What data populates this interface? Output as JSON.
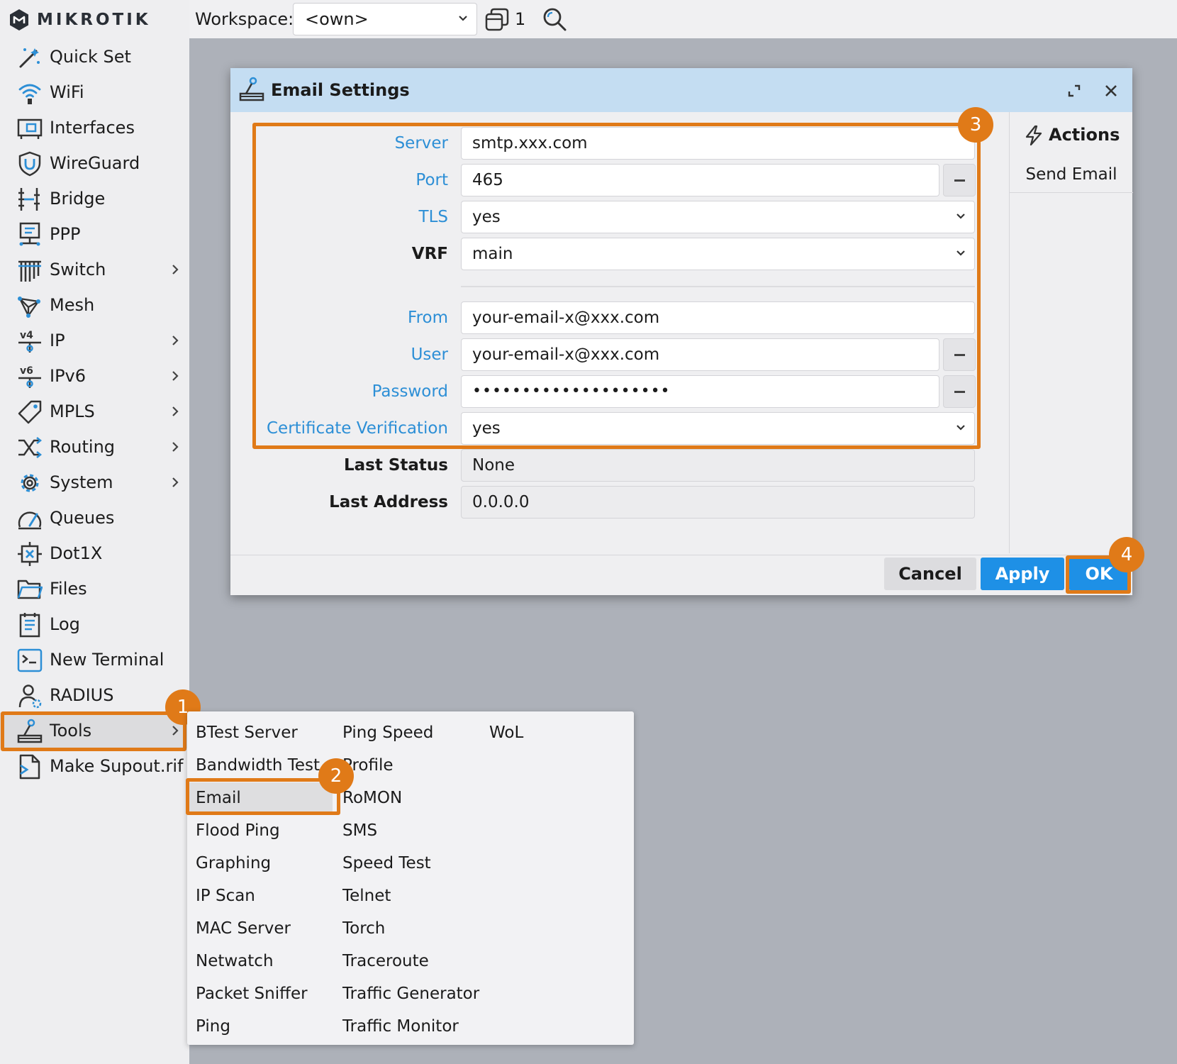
{
  "app": {
    "brand": "MikroTik",
    "logo_text": "MIKROTIK"
  },
  "colors": {
    "accent": "#e07a18",
    "primary_button": "#1e90e6",
    "field_label_blue": "#2d8fd6",
    "dialog_header": "#c4ddf2"
  },
  "topbar": {
    "workspace_label": "Workspace:",
    "workspace_value": "<own>",
    "window_count": "1"
  },
  "sidebar": {
    "items": [
      {
        "label": "Quick Set",
        "icon": "wand-icon",
        "submenu": false
      },
      {
        "label": "WiFi",
        "icon": "wifi-icon",
        "submenu": false
      },
      {
        "label": "Interfaces",
        "icon": "interfaces-icon",
        "submenu": false
      },
      {
        "label": "WireGuard",
        "icon": "wireguard-icon",
        "submenu": false
      },
      {
        "label": "Bridge",
        "icon": "bridge-icon",
        "submenu": false
      },
      {
        "label": "PPP",
        "icon": "ppp-icon",
        "submenu": false
      },
      {
        "label": "Switch",
        "icon": "switch-icon",
        "submenu": true
      },
      {
        "label": "Mesh",
        "icon": "mesh-icon",
        "submenu": false
      },
      {
        "label": "IP",
        "icon": "ip-icon",
        "submenu": true
      },
      {
        "label": "IPv6",
        "icon": "ipv6-icon",
        "submenu": true
      },
      {
        "label": "MPLS",
        "icon": "mpls-icon",
        "submenu": true
      },
      {
        "label": "Routing",
        "icon": "routing-icon",
        "submenu": true
      },
      {
        "label": "System",
        "icon": "gear-icon",
        "submenu": true
      },
      {
        "label": "Queues",
        "icon": "queues-icon",
        "submenu": false
      },
      {
        "label": "Dot1X",
        "icon": "dot1x-icon",
        "submenu": false
      },
      {
        "label": "Files",
        "icon": "folder-icon",
        "submenu": false
      },
      {
        "label": "Log",
        "icon": "log-icon",
        "submenu": false
      },
      {
        "label": "New Terminal",
        "icon": "terminal-icon",
        "submenu": false
      },
      {
        "label": "RADIUS",
        "icon": "radius-icon",
        "submenu": false
      },
      {
        "label": "Tools",
        "icon": "tools-icon",
        "submenu": true,
        "active": true
      },
      {
        "label": "Make Supout.rif",
        "icon": "supout-icon",
        "submenu": false
      }
    ]
  },
  "dialog": {
    "title": "Email Settings",
    "fields": {
      "server": {
        "label": "Server",
        "value": "smtp.xxx.com"
      },
      "port": {
        "label": "Port",
        "value": "465"
      },
      "tls": {
        "label": "TLS",
        "value": "yes"
      },
      "vrf": {
        "label": "VRF",
        "value": "main"
      },
      "from": {
        "label": "From",
        "value": "your-email-x@xxx.com"
      },
      "user": {
        "label": "User",
        "value": "your-email-x@xxx.com"
      },
      "password": {
        "label": "Password",
        "value": "••••••••••••••••••••"
      },
      "cert": {
        "label": "Certificate Verification",
        "value": "yes"
      },
      "last_status": {
        "label": "Last Status",
        "value": "None"
      },
      "last_address": {
        "label": "Last Address",
        "value": "0.0.0.0"
      }
    },
    "actions": {
      "title": "Actions",
      "send_email": "Send Email"
    },
    "buttons": {
      "cancel": "Cancel",
      "apply": "Apply",
      "ok": "OK"
    }
  },
  "tools_menu": {
    "col1": [
      "BTest Server",
      "Bandwidth Test",
      "Email",
      "Flood Ping",
      "Graphing",
      "IP Scan",
      "MAC Server",
      "Netwatch",
      "Packet Sniffer",
      "Ping"
    ],
    "col2": [
      "Ping Speed",
      "Profile",
      "RoMON",
      "SMS",
      "Speed Test",
      "Telnet",
      "Torch",
      "Traceroute",
      "Traffic Generator",
      "Traffic Monitor"
    ],
    "col3": [
      "WoL"
    ],
    "active": "Email"
  },
  "steps": {
    "s1": "1",
    "s2": "2",
    "s3": "3",
    "s4": "4"
  }
}
